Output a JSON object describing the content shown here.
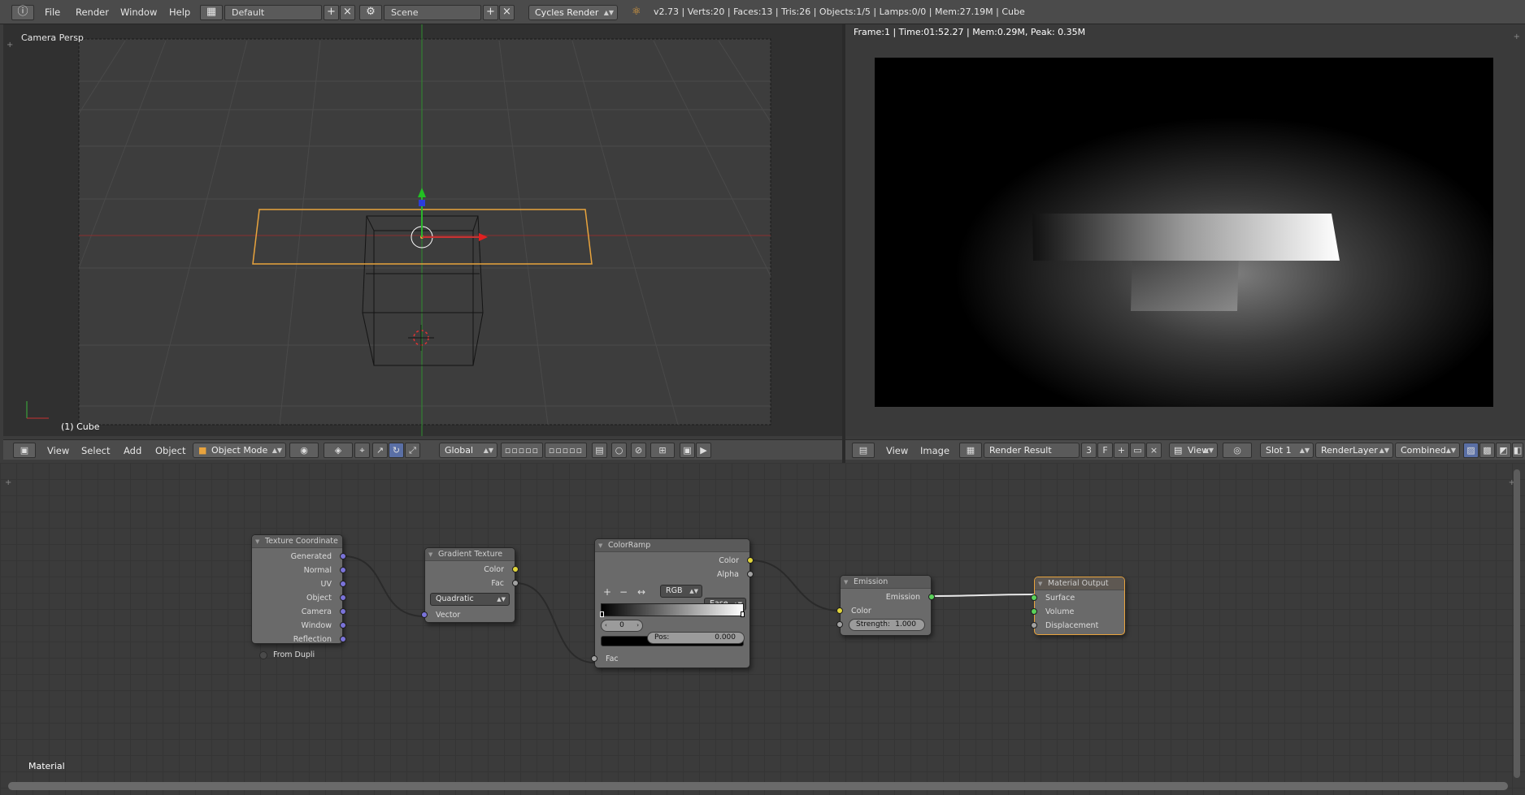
{
  "topbar": {
    "menus": [
      "File",
      "Render",
      "Window",
      "Help"
    ],
    "screen_layout": "Default",
    "scene": "Scene",
    "render_engine": "Cycles Render",
    "stats": "v2.73 | Verts:20 | Faces:13 | Tris:26 | Objects:1/5 | Lamps:0/0 | Mem:27.19M | Cube"
  },
  "viewport3d": {
    "view_label": "Camera Persp",
    "object_label": "(1) Cube",
    "header": {
      "menus": [
        "View",
        "Select",
        "Add",
        "Object"
      ],
      "mode": "Object Mode",
      "orientation": "Global"
    }
  },
  "image_editor": {
    "info": "Frame:1 | Time:01:52.27 | Mem:0.29M, Peak: 0.35M",
    "header": {
      "menus": [
        "View",
        "Image"
      ],
      "image_name": "Render Result",
      "users": "3",
      "fake_user": "F",
      "view": "View",
      "slot": "Slot 1",
      "layer": "RenderLayer",
      "pass": "Combined"
    }
  },
  "node_editor": {
    "label": "Material",
    "nodes": {
      "texcoord": {
        "title": "Texture Coordinate",
        "outputs": [
          "Generated",
          "Normal",
          "UV",
          "Object",
          "Camera",
          "Window",
          "Reflection"
        ],
        "option": "From Dupli"
      },
      "gradient": {
        "title": "Gradient Texture",
        "outputs": [
          "Color",
          "Fac"
        ],
        "type": "Quadratic",
        "input": "Vector"
      },
      "colorramp": {
        "title": "ColorRamp",
        "outputs": [
          "Color",
          "Alpha"
        ],
        "plus": "+",
        "minus": "−",
        "flip": "↔",
        "color_mode": "RGB",
        "interpolation": "Ease",
        "index": "0",
        "pos_label": "Pos:",
        "pos_value": "0.000",
        "input": "Fac"
      },
      "emission": {
        "title": "Emission",
        "output": "Emission",
        "input": "Color",
        "strength_label": "Strength:",
        "strength_value": "1.000"
      },
      "output": {
        "title": "Material Output",
        "inputs": [
          "Surface",
          "Volume",
          "Displacement"
        ]
      }
    }
  },
  "colors": {
    "selection_orange": "#e8a33d",
    "x_axis": "#c83232",
    "y_axis": "#3bb53b",
    "socket_purple": "#7a73d9",
    "socket_yellow": "#e0d43a",
    "socket_green": "#5ad25a"
  }
}
